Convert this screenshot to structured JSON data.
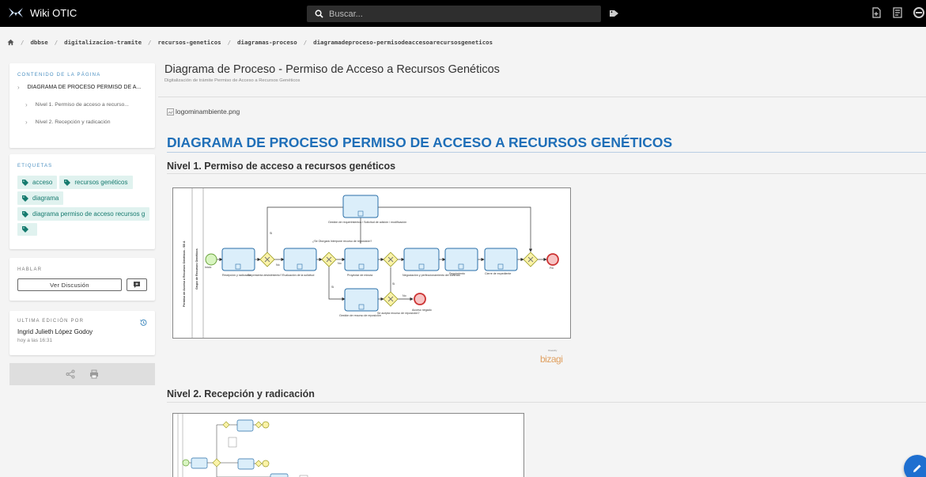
{
  "app": {
    "title": "Wiki OTIC"
  },
  "search": {
    "placeholder": "Buscar..."
  },
  "breadcrumb": [
    "dbbse",
    "digitalizacion-tramite",
    "recursos-geneticos",
    "diagramas-proceso",
    "diagramadeproceso-permisodeaccesoarecursosgeneticos"
  ],
  "toc": {
    "heading": "CONTENIDO DE LA PÁGINA",
    "items": [
      {
        "label": "DIAGRAMA DE PROCESO PERMISO DE A..."
      },
      {
        "label": "Nivel 1. Permiso de acceso a recurso..."
      },
      {
        "label": "Nivel 2. Recepción y radicación"
      }
    ]
  },
  "tags": {
    "heading": "ETIQUETAS",
    "items": [
      "acceso",
      "recursos genéticos",
      "diagrama",
      "diagrama permiso de acceso recursos g",
      ""
    ]
  },
  "talk": {
    "heading": "HABLAR",
    "button": "Ver Discusión"
  },
  "last_edit": {
    "heading": "ULTIMA EDICIÓN POR",
    "editor": "Ingrid Julieth López Godoy",
    "time": "hoy a las 16:31"
  },
  "page": {
    "title": "Diagrama de Proceso - Permiso de Acceso a Recursos Genéticos",
    "subtitle": "Digitalización de trámite Permiso de Acceso a Recursos Genéticos",
    "image_alt": "logominambiente.png",
    "h1": "DIAGRAMA DE PROCESO PERMISO DE ACCESO A RECURSOS GENÉTICOS",
    "h2_1": "Nivel 1. Permiso de acceso a recursos genéticos",
    "h2_2": "Nivel 2. Recepción y radicación"
  },
  "diagram1": {
    "pool": "Permiso de Acceso a Recursos Genéticos - SB A",
    "lane": "Grupo de Recursos Genéticos",
    "start": "Inicio",
    "tasks": [
      "Recepción y radicación",
      "Evaluación de la solicitud",
      "Proyectar de minuta",
      "Negociación y perfeccionamiento del contrato",
      "Seguimiento",
      "Cierre de expediente",
      "Gestión de requerimientos / Solicitud de adición / modificación",
      "Gestión de recurso de reposición"
    ],
    "gateways": [
      "Se presenta desistimiento?",
      "¿Se Otorgará Interpone recurso de reposición?",
      "Se acepta recurso de reposición?"
    ],
    "flows": [
      "Si",
      "No",
      "Si",
      "No",
      "Si",
      "No"
    ],
    "ends": [
      "Fin",
      "Acceso negado"
    ]
  },
  "bizagi": {
    "brand": "bizagi",
    "powered": "Powered by",
    "tag": "Modeler"
  },
  "colors": {
    "topbar": "#000000",
    "accent": "#1f6fb8",
    "tag_bg": "#e0f2ef",
    "tag_fg": "#157a6e",
    "fab": "#1e6fd0"
  },
  "icons": [
    "wiki-logo-icon",
    "search-icon",
    "tag-icon",
    "new-page-icon",
    "page-list-icon",
    "account-icon",
    "home-icon",
    "chevron-right-icon",
    "comment-icon",
    "history-icon",
    "share-icon",
    "print-icon",
    "broken-image-icon",
    "pencil-icon"
  ]
}
